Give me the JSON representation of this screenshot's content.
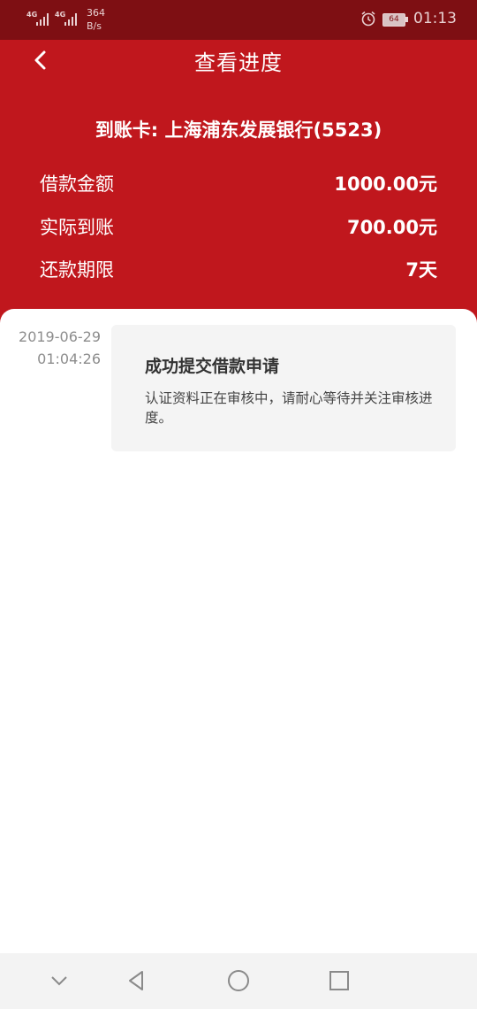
{
  "status_bar": {
    "network1": "4G",
    "network2": "4G",
    "speed_value": "364",
    "speed_unit": "B/s",
    "battery": "64",
    "time": "01:13"
  },
  "header": {
    "title": "查看进度",
    "card_line": "到账卡:  上海浦东发展银行(5523)",
    "rows": [
      {
        "label": "借款金额",
        "value": "1000.00元"
      },
      {
        "label": "实际到账",
        "value": "700.00元"
      },
      {
        "label": "还款期限",
        "value": "7天"
      }
    ]
  },
  "timeline": [
    {
      "date": "2019-06-29",
      "time": "01:04:26",
      "title": "成功提交借款申请",
      "description": "认证资料正在审核中，请耐心等待并关注审核进度。"
    }
  ],
  "icons": {
    "back": "chevron-left-icon",
    "nav_down": "chevron-down-icon",
    "nav_back": "triangle-back-icon",
    "nav_home": "circle-home-icon",
    "nav_recents": "square-recents-icon"
  },
  "colors": {
    "status_bar_bg": "#7e0f13",
    "header_bg": "#c0171d",
    "card_bg": "#f4f4f4",
    "nav_bg": "#f3f3f3"
  }
}
